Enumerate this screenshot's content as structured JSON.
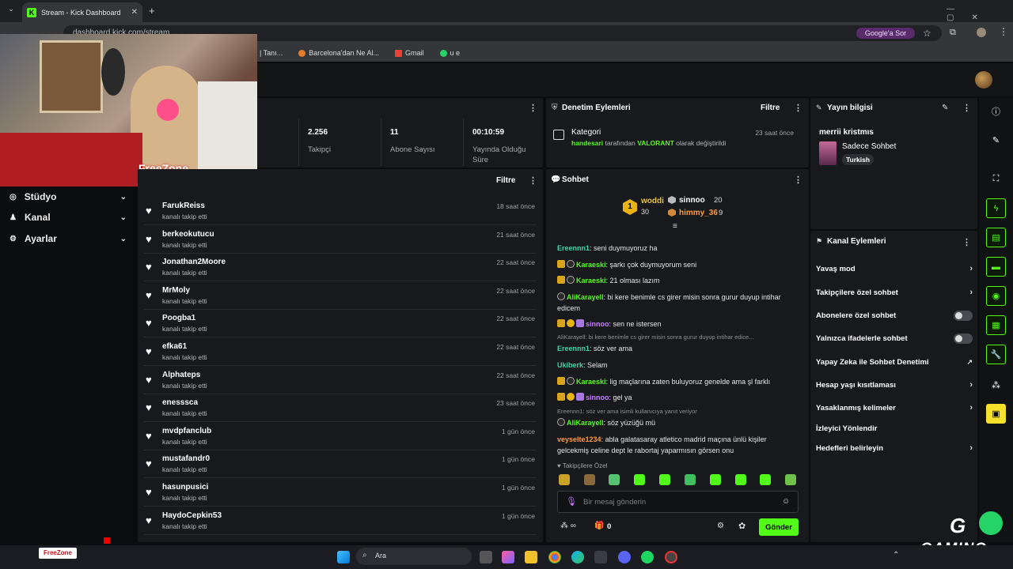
{
  "browser": {
    "tab_title": "Stream - Kick Dashboard",
    "url": "dashboard.kick.com/stream",
    "google_sor": "Google'a Sor",
    "bookmarks": [
      "ük | Tanı...",
      "Barcelona'dan Ne Al...",
      "Gmail",
      "u e"
    ]
  },
  "webcam": {
    "overlay_text": "FreeZone"
  },
  "nav": {
    "items": [
      {
        "label": "Stüdyo"
      },
      {
        "label": "Kanal"
      },
      {
        "label": "Ayarlar"
      }
    ]
  },
  "stats": {
    "followers": {
      "value": "2.256",
      "label": "Takipçi"
    },
    "subs": {
      "value": "11",
      "label": "Abone Sayısı"
    },
    "uptime": {
      "value": "00:10:59",
      "label": "Yayında Olduğu Süre"
    }
  },
  "followers_panel": {
    "filter": "Filtre",
    "rows": [
      {
        "name": "FarukReiss",
        "action": "kanalı takip etti",
        "time": "18 saat önce"
      },
      {
        "name": "berkeokutucu",
        "action": "kanalı takip etti",
        "time": "21 saat önce"
      },
      {
        "name": "Jonathan2Moore",
        "action": "kanalı takip etti",
        "time": "22 saat önce"
      },
      {
        "name": "MrMoly",
        "action": "kanalı takip etti",
        "time": "22 saat önce"
      },
      {
        "name": "Poogba1",
        "action": "kanalı takip etti",
        "time": "22 saat önce"
      },
      {
        "name": "efka61",
        "action": "kanalı takip etti",
        "time": "22 saat önce"
      },
      {
        "name": "Alphateps",
        "action": "kanalı takip etti",
        "time": "22 saat önce"
      },
      {
        "name": "enesssca",
        "action": "kanalı takip etti",
        "time": "23 saat önce"
      },
      {
        "name": "mvdpfanclub",
        "action": "kanalı takip etti",
        "time": "1 gün önce"
      },
      {
        "name": "mustafandr0",
        "action": "kanalı takip etti",
        "time": "1 gün önce"
      },
      {
        "name": "hasunpusici",
        "action": "kanalı takip etti",
        "time": "1 gün önce"
      },
      {
        "name": "HaydoCepkin53",
        "action": "kanalı takip etti",
        "time": "1 gün önce"
      }
    ]
  },
  "moderation": {
    "title": "Denetim Eylemleri",
    "filter": "Filtre",
    "event_title": "Kategori",
    "event_user": "handesari",
    "event_mid": "tarafından",
    "event_cat": "VALORANT",
    "event_end": "olarak değiştirildi",
    "event_time": "23 saat önce"
  },
  "chat": {
    "title": "Sohbet",
    "leaderboard": {
      "first": {
        "name": "woddi",
        "count": "30"
      },
      "second": {
        "name": "sinnoo",
        "count": "20"
      },
      "third": {
        "name": "himmy_36",
        "count": "9"
      }
    },
    "messages": [
      {
        "user": "Ereennn1",
        "text": ": seni duymuyoruz ha"
      },
      {
        "user": "Karaeski",
        "text": ": şarkı çok duymuyorum seni"
      },
      {
        "user": "Karaeski",
        "text": ": 21 olması lazım"
      },
      {
        "user": "AliKarayell",
        "text": ": bi kere benimle cs girer misin sonra gurur duyup intihar edicem"
      },
      {
        "user": "sinnoo",
        "text": ": sen ne istersen"
      },
      {
        "reply": "AliKarayell: bi kere benimle cs girer misin sonra gurur duyup intihar edice..."
      },
      {
        "user": "Ereennn1",
        "text": ": söz ver ama"
      },
      {
        "user": "Ukiberk",
        "text": ": Selam"
      },
      {
        "user": "Karaeski",
        "text": ": lig maçlarına zaten buluyoruz genelde ama şl farklı"
      },
      {
        "user": "sinnoo",
        "text": ": gel ya"
      },
      {
        "reply": "Ereennn1: söz ver ama isimli kullanıcıya yanıt veriyor"
      },
      {
        "user": "AliKarayell",
        "text": ": söz yüzüğü mü"
      },
      {
        "user": "veyselte1234",
        "text": ": abla galatasaray atletico madrid maçına ünlü kişiler gelcekmiş celine dept le rabortaj yaparmısın görsen onu"
      }
    ],
    "followers_only": "Takipçilere Özel",
    "input_placeholder": "Bir mesaj gönderin",
    "footer_count": "0",
    "send": "Gönder"
  },
  "stream_info": {
    "title": "Yayın bilgisi",
    "stream_title": "merrii kristmıs",
    "category": "Sadece Sohbet",
    "tag": "Turkish"
  },
  "channel_actions": {
    "title": "Kanal Eylemleri",
    "items": [
      {
        "label": "Yavaş mod",
        "control": "arrow"
      },
      {
        "label": "Takipçilere özel sohbet",
        "control": "arrow"
      },
      {
        "label": "Abonelere özel sohbet",
        "control": "toggle"
      },
      {
        "label": "Yalnızca ifadelerle sohbet",
        "control": "toggle"
      },
      {
        "label": "Yapay Zeka ile Sohbet Denetimi",
        "control": "external"
      },
      {
        "label": "Hesap yaşı kısıtlaması",
        "control": "arrow"
      },
      {
        "label": "Yasaklanmış kelimeler",
        "control": "arrow"
      },
      {
        "label": "İzleyici Yönlendir",
        "control": "none"
      },
      {
        "label": "Hedefleri belirleyin",
        "control": "arrow"
      }
    ]
  },
  "taskbar": {
    "search": "Ara"
  },
  "watermark": {
    "gaming": "GAMING",
    "freezone": "FreeZone"
  },
  "colors": {
    "kick_green": "#53fc18",
    "panel": "#18191c",
    "bg": "#0b0c0e"
  }
}
